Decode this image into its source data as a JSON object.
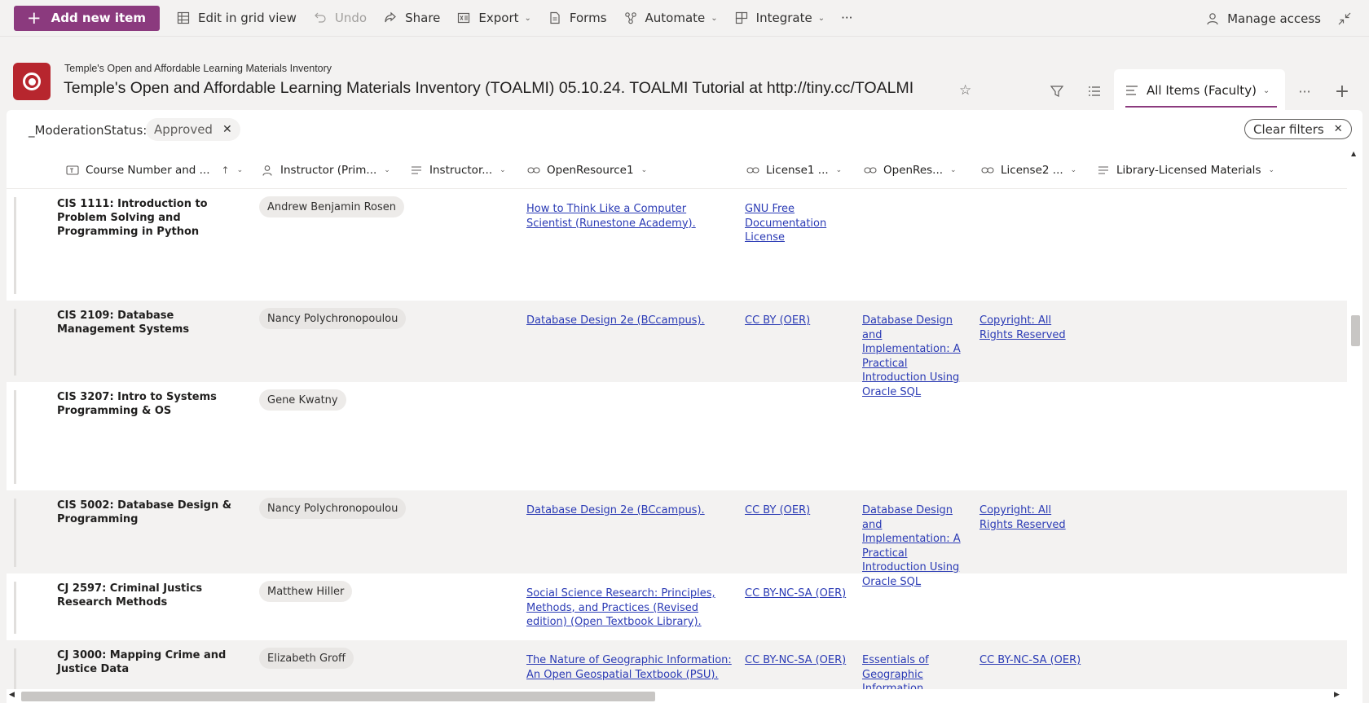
{
  "commandbar": {
    "add_new_item": "Add new item",
    "edit_grid": "Edit in grid view",
    "undo": "Undo",
    "share": "Share",
    "export": "Export",
    "forms": "Forms",
    "automate": "Automate",
    "integrate": "Integrate",
    "more": "···",
    "manage_access": "Manage access"
  },
  "header": {
    "site_name": "Temple's Open and Affordable Learning Materials Inventory",
    "list_title": "Temple's Open and Affordable Learning Materials Inventory (TOALMI) 05.10.24. TOALMI Tutorial at http://tiny.cc/TOALMI",
    "view_name": "All Items (Faculty)",
    "more": "···"
  },
  "filter": {
    "label": "_ModerationStatus:",
    "chip": "Approved",
    "clear": "Clear filters"
  },
  "columns": [
    "Course Number and ...",
    "Instructor (Prim...",
    "Instructor...",
    "OpenResource1",
    "License1 ...",
    "OpenRes...",
    "License2 ...",
    "Library-Licensed Materials"
  ],
  "rows": [
    {
      "course": "CIS 1111: Introduction to Problem Solving and Programming in Python",
      "instructor": "Andrew Benjamin Rosen",
      "open_resource1": "How to Think Like a Computer Scientist (Runestone Academy).",
      "license1": "GNU Free Documentation License",
      "open_resource2": "",
      "license2": ""
    },
    {
      "course": "CIS 2109: Database Management Systems",
      "instructor": "Nancy Polychronopoulou",
      "open_resource1": "Database Design 2e (BCcampus).",
      "license1": "CC BY (OER)",
      "open_resource2": "Database Design and Implementation: A Practical Introduction Using Oracle SQL",
      "license2": "Copyright: All Rights Reserved"
    },
    {
      "course": "CIS 3207: Intro to Systems Programming & OS",
      "instructor": "Gene Kwatny",
      "open_resource1": "",
      "license1": "",
      "open_resource2": "",
      "license2": ""
    },
    {
      "course": "CIS 5002: Database Design & Programming",
      "instructor": "Nancy Polychronopoulou",
      "open_resource1": "Database Design 2e (BCcampus).",
      "license1": "CC BY (OER)",
      "open_resource2": "Database Design and Implementation: A Practical Introduction Using Oracle SQL",
      "license2": "Copyright: All Rights Reserved"
    },
    {
      "course": "CJ 2597: Criminal Justics Research Methods",
      "instructor": "Matthew Hiller",
      "open_resource1": "Social Science Research: Principles, Methods, and Practices (Revised edition) (Open Textbook Library).",
      "license1": "CC BY-NC-SA (OER)",
      "open_resource2": "",
      "license2": ""
    },
    {
      "course": "CJ 3000: Mapping Crime and Justice Data",
      "instructor": "Elizabeth Groff",
      "open_resource1": "The Nature of Geographic Information: An Open Geospatial Textbook (PSU).",
      "license1": "CC BY-NC-SA (OER)",
      "open_resource2": "Essentials of Geographic Information Systems",
      "license2": "CC BY-NC-SA (OER)"
    }
  ]
}
